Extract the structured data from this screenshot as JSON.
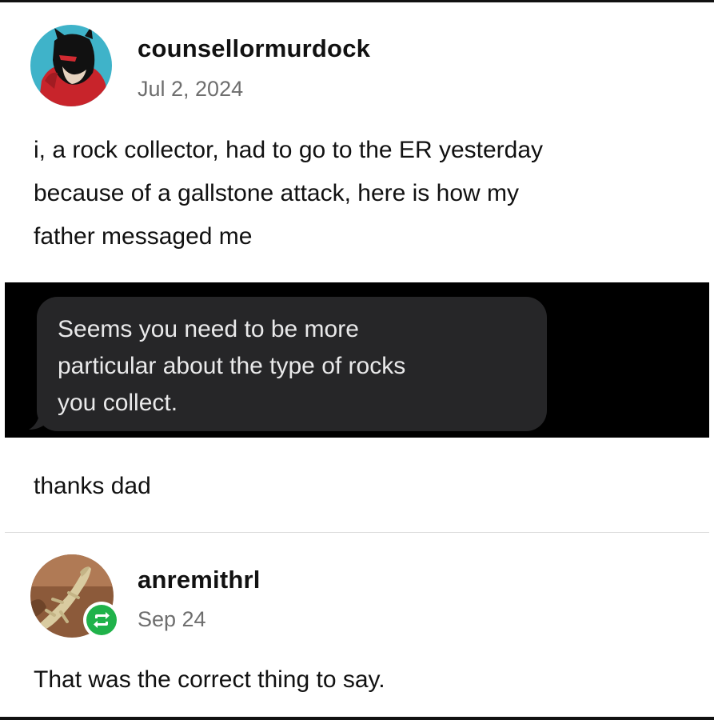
{
  "post": {
    "author": "counsellormurdock",
    "date": "Jul 2, 2024",
    "body_lines": [
      "i, a rock collector, had to go to the ER yesterday",
      "because of a gallstone attack, here is how my",
      "father messaged me"
    ],
    "message_lines": [
      "Seems you need to be more",
      "particular about the type of rocks",
      "you collect."
    ],
    "caption": "thanks dad"
  },
  "reply": {
    "author": "anremithrl",
    "date": "Sep 24",
    "body": "That was the correct thing to say."
  },
  "colors": {
    "message_bubble": "#262628",
    "reblog_badge": "#20b24a"
  },
  "icons": {
    "reblog": "reblog-icon"
  }
}
